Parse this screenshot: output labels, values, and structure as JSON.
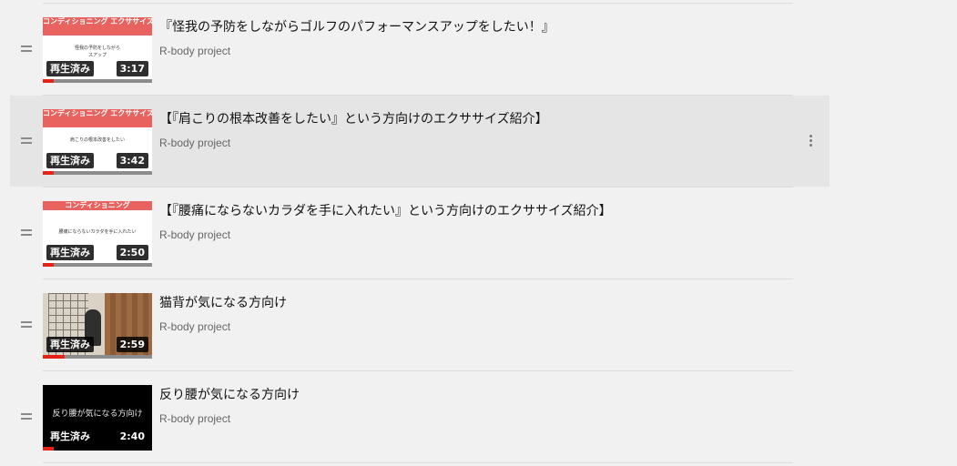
{
  "playlist": {
    "items": [
      {
        "title": "『怪我の予防をしながらゴルフのパフォーマンスアップをしたい！』",
        "channel": "R-body project",
        "watched_label": "再生済み",
        "duration": "3:17",
        "progress": 0.1,
        "thumb_banner": "コンディショニング エクササイズ紹介",
        "thumb_sub": "怪我の予防をしながら",
        "thumb_sub2": "スアップ"
      },
      {
        "title": "【『肩こりの根本改善をしたい』という方向けのエクササイズ紹介】",
        "channel": "R-body project",
        "watched_label": "再生済み",
        "duration": "3:42",
        "progress": 0.1,
        "thumb_banner": "コンディショニング エクササイズ紹介",
        "thumb_sub": "肩こりの根本改善をしたい"
      },
      {
        "title": "【『腰痛にならないカラダを手に入れたい』という方向けのエクササイズ紹介】",
        "channel": "R-body project",
        "watched_label": "再生済み",
        "duration": "2:50",
        "progress": 0.1,
        "thumb_banner": "コンディショニング",
        "thumb_sub": "腰痛にならないカラダを手に入れたい"
      },
      {
        "title": "猫背が気になる方向け",
        "channel": "R-body project",
        "watched_label": "再生済み",
        "duration": "2:59",
        "progress": 0.2
      },
      {
        "title": "反り腰が気になる方向け",
        "channel": "R-body project",
        "watched_label": "再生済み",
        "duration": "2:40",
        "progress": 0.1,
        "thumb_text": "反り腰が気になる方向け"
      }
    ]
  },
  "colors": {
    "progress": "#e62117",
    "banner": "#e8625f",
    "hover_row": "#e5e5e5"
  },
  "icons": {
    "drag_handle": "drag-handle-icon",
    "more_menu": "more-vert-icon"
  }
}
